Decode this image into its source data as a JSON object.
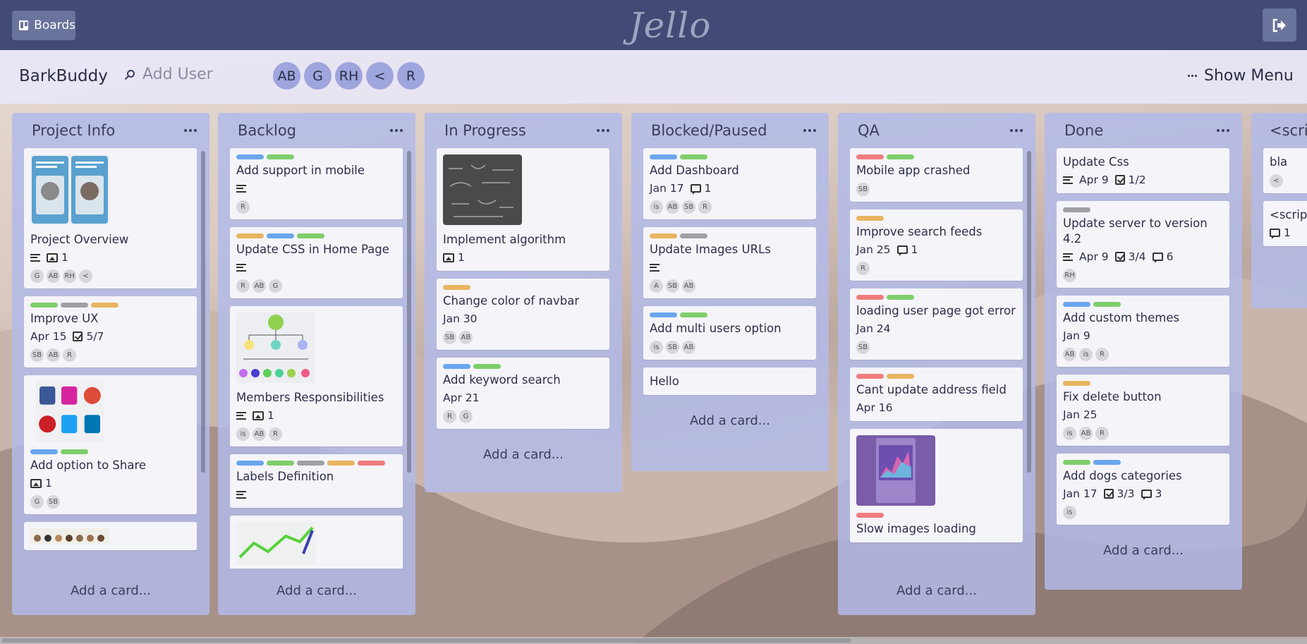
{
  "header": {
    "boards_label": "Boards",
    "logo": "Jello"
  },
  "board": {
    "title": "BarkBuddy",
    "add_user_placeholder": "Add User",
    "members": [
      "AB",
      "G",
      "RH",
      "<",
      "R"
    ],
    "show_menu": "Show Menu"
  },
  "add_card_label": "Add a card...",
  "label_colors": {
    "blue": "#6aa6ee",
    "green": "#7ece6a",
    "gray": "#9ea0a4",
    "orange": "#e8b560",
    "red": "#ef7d7d"
  },
  "lists": [
    {
      "title": "Project Info",
      "cards": [
        {
          "title": "Project Overview",
          "images": "1",
          "avatars": [
            "G",
            "AB",
            "RH",
            "<"
          ]
        },
        {
          "title": "Improve UX",
          "due": "Apr 15",
          "checklist": "5/7",
          "avatars": [
            "SB",
            "AB",
            "R"
          ]
        },
        {
          "title": "Add option to Share",
          "images": "1",
          "avatars": [
            "G",
            "SB"
          ]
        }
      ]
    },
    {
      "title": "Backlog",
      "cards": [
        {
          "title": "Add support in mobile",
          "avatars": [
            "R"
          ]
        },
        {
          "title": "Update CSS in Home Page",
          "avatars": [
            "R",
            "AB",
            "G"
          ]
        },
        {
          "title": "Members Responsibilities",
          "images": "1",
          "avatars": [
            "is",
            "AB",
            "R"
          ]
        },
        {
          "title": "Labels Definition"
        }
      ]
    },
    {
      "title": "In Progress",
      "cards": [
        {
          "title": "Implement algorithm",
          "images": "1"
        },
        {
          "title": "Change color of navbar",
          "due": "Jan 30",
          "avatars": [
            "SB",
            "AB"
          ]
        },
        {
          "title": "Add keyword search",
          "due": "Apr 21",
          "avatars": [
            "R",
            "G"
          ]
        }
      ]
    },
    {
      "title": "Blocked/Paused",
      "cards": [
        {
          "title": "Add Dashboard",
          "due": "Jan 17",
          "comments": "1",
          "avatars": [
            "is",
            "AB",
            "SB",
            "R"
          ]
        },
        {
          "title": "Update Images URLs",
          "avatars": [
            "A",
            "SB",
            "AB"
          ]
        },
        {
          "title": "Add multi users option",
          "avatars": [
            "is",
            "SB",
            "AB"
          ]
        },
        {
          "title": "Hello"
        }
      ]
    },
    {
      "title": "QA",
      "cards": [
        {
          "title": "Mobile app crashed",
          "avatars": [
            "SB"
          ]
        },
        {
          "title": "Improve search feeds",
          "due": "Jan 25",
          "comments": "1",
          "avatars": [
            "R"
          ]
        },
        {
          "title": "loading user page got error",
          "due": "Jan 24",
          "avatars": [
            "SB"
          ]
        },
        {
          "title": "Cant update address field",
          "due": "Apr 16"
        },
        {
          "title": "Slow images loading"
        }
      ]
    },
    {
      "title": "Done",
      "cards": [
        {
          "title": "Update Css",
          "due": "Apr 9",
          "checklist": "1/2"
        },
        {
          "title": "Update server to version 4.2",
          "due": "Apr 9",
          "checklist": "3/4",
          "comments": "6",
          "avatars": [
            "RH"
          ]
        },
        {
          "title": "Add custom themes",
          "due": "Jan 9",
          "avatars": [
            "AB",
            "is",
            "R"
          ]
        },
        {
          "title": "Fix delete button",
          "due": "Jan 25",
          "avatars": [
            "is",
            "AB",
            "R"
          ]
        },
        {
          "title": "Add dogs categories",
          "due": "Jan 17",
          "checklist": "3/3",
          "comments": "3",
          "avatars": [
            "is"
          ]
        }
      ]
    },
    {
      "title": "<scrip",
      "cards": [
        {
          "title": "bla",
          "avatars": [
            "<"
          ]
        },
        {
          "title": "<script",
          "comments": "1"
        }
      ]
    }
  ]
}
